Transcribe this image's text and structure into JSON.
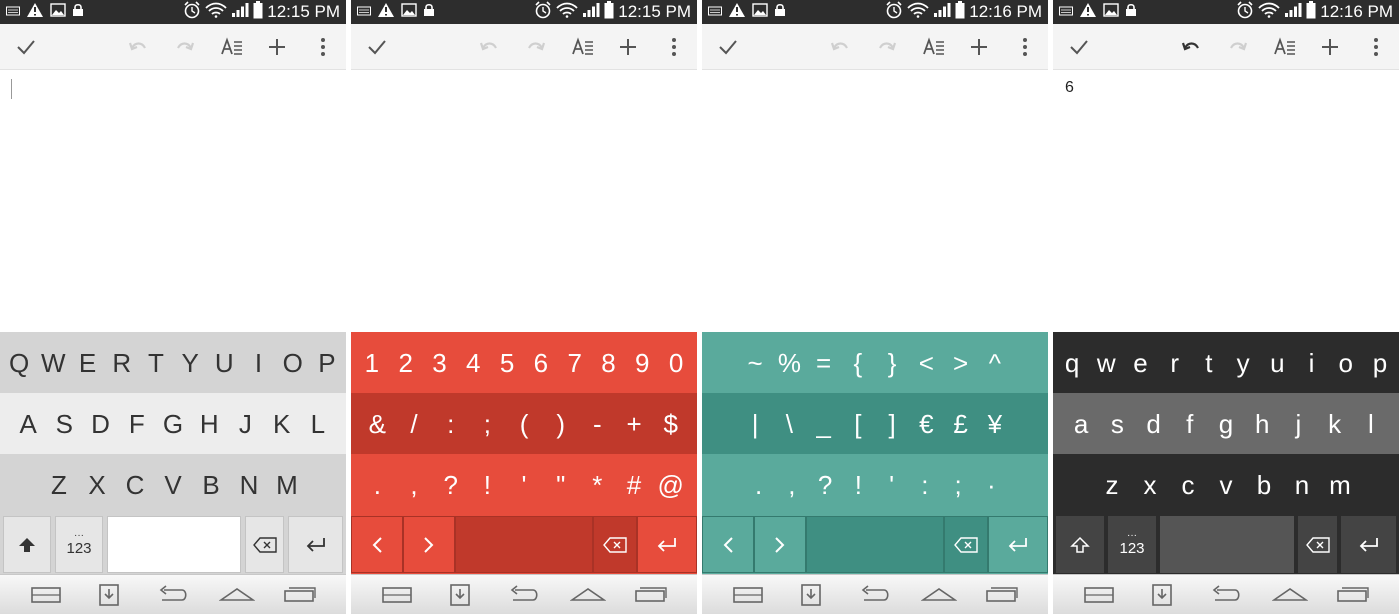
{
  "screens": [
    {
      "status": {
        "time": "12:15 PM"
      },
      "doc_text": "",
      "rows": [
        [
          "Q",
          "W",
          "E",
          "R",
          "T",
          "Y",
          "U",
          "I",
          "O",
          "P"
        ],
        [
          "A",
          "S",
          "D",
          "F",
          "G",
          "H",
          "J",
          "K",
          "L"
        ],
        [
          "Z",
          "X",
          "C",
          "V",
          "B",
          "N",
          "M"
        ]
      ],
      "num_key": "123",
      "num_key_dots": "···"
    },
    {
      "status": {
        "time": "12:15 PM"
      },
      "doc_text": "",
      "rows": [
        [
          "1",
          "2",
          "3",
          "4",
          "5",
          "6",
          "7",
          "8",
          "9",
          "0"
        ],
        [
          "&",
          "/",
          ":",
          ";",
          "(",
          ")",
          "-",
          "+",
          "$"
        ],
        [
          ".",
          ",",
          "?",
          "!",
          "'",
          "\"",
          "*",
          "#",
          "@"
        ]
      ]
    },
    {
      "status": {
        "time": "12:16 PM"
      },
      "doc_text": "",
      "rows": [
        [
          "~",
          "%",
          "=",
          "{",
          "}",
          "<",
          ">",
          "^"
        ],
        [
          "|",
          "\\",
          "_",
          "[",
          "]",
          "€",
          "£",
          "¥"
        ],
        [
          ".",
          ",",
          "?",
          "!",
          "'",
          ":",
          ";",
          "·"
        ]
      ]
    },
    {
      "status": {
        "time": "12:16 PM"
      },
      "doc_text": "6",
      "rows": [
        [
          "q",
          "w",
          "e",
          "r",
          "t",
          "y",
          "u",
          "i",
          "o",
          "p"
        ],
        [
          "a",
          "s",
          "d",
          "f",
          "g",
          "h",
          "j",
          "k",
          "l"
        ],
        [
          "z",
          "x",
          "c",
          "v",
          "b",
          "n",
          "m"
        ]
      ],
      "num_key": "123",
      "num_key_dots": "···"
    }
  ],
  "themes": {
    "light": {
      "row1": "#d4d4d4",
      "row2": "#ededed",
      "row3": "#d4d4d4",
      "row4": "#d4d4d4",
      "key_text": "#333333"
    },
    "red": {
      "row1": "#e74c3c",
      "row2": "#c0392b",
      "row3": "#e74c3c",
      "row4": "#e74c3c",
      "key_text": "#ffffff"
    },
    "teal": {
      "row1": "#5aaa9c",
      "row2": "#3f8f82",
      "row3": "#5aaa9c",
      "row4": "#5aaa9c",
      "key_text": "#ffffff"
    },
    "dark": {
      "row1": "#2c2c2c",
      "row2": "#6a6a6a",
      "row3": "#2c2c2c",
      "row4": "#2c2c2c",
      "key_text": "#ffffff"
    }
  },
  "icons": [
    "keyboard-icon",
    "warning-icon",
    "image-icon",
    "lock-icon",
    "alarm-icon",
    "wifi-icon",
    "signal-icon",
    "battery-icon",
    "check-icon",
    "undo-icon",
    "redo-icon",
    "text-format-icon",
    "add-icon",
    "more-icon",
    "shift-icon",
    "backspace-icon",
    "enter-icon",
    "chevron-left-icon",
    "chevron-right-icon",
    "keyboard-switch-icon",
    "hide-keyboard-icon",
    "back-icon",
    "home-icon",
    "recents-icon"
  ]
}
